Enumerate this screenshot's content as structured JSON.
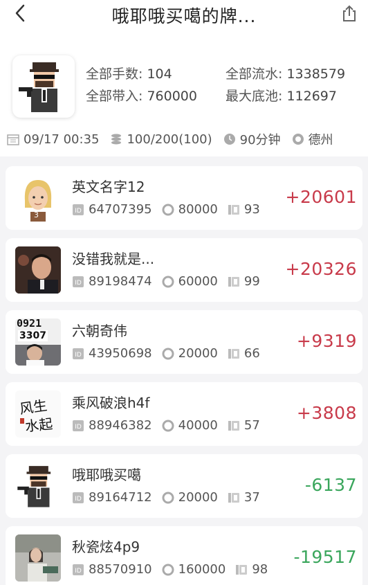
{
  "header": {
    "title": "哦耶哦买噶的牌...",
    "back_icon": "chevron-left-icon",
    "share_icon": "share-icon"
  },
  "summary": {
    "total_hands_label": "全部手数:",
    "total_hands": "104",
    "total_flow_label": "全部流水:",
    "total_flow": "1338579",
    "total_buyin_label": "全部带入:",
    "total_buyin": "760000",
    "max_pot_label": "最大底池:",
    "max_pot": "112697"
  },
  "meta": {
    "datetime": "09/17 00:35",
    "blinds": "100/200(100)",
    "duration": "90分钟",
    "game_type": "德州"
  },
  "players": [
    {
      "name": "英文名字12",
      "id": "64707395",
      "buyin": "80000",
      "hands": "93",
      "score": "+20601",
      "badge": "3",
      "avatar": "blonde-woman-avatar"
    },
    {
      "name": "没错我就是...",
      "id": "89198474",
      "buyin": "60000",
      "hands": "99",
      "score": "+20326",
      "avatar": "photo-man-avatar"
    },
    {
      "name": "六朝奇伟",
      "id": "43950698",
      "buyin": "20000",
      "hands": "66",
      "score": "+9319",
      "avatar_text1": "0921",
      "avatar_text2": "3307",
      "avatar": "photo-plate-avatar"
    },
    {
      "name": "乘风破浪h4f",
      "id": "88946382",
      "buyin": "40000",
      "hands": "57",
      "score": "+3808",
      "avatar_text1": "风生",
      "avatar_text2": "水起",
      "avatar": "calligraphy-avatar"
    },
    {
      "name": "哦耶哦买噶",
      "id": "89164712",
      "buyin": "20000",
      "hands": "37",
      "score": "-6137",
      "avatar": "gangster-avatar"
    },
    {
      "name": "秋瓷炫4p9",
      "id": "88570910",
      "buyin": "160000",
      "hands": "98",
      "score": "-19517",
      "avatar": "photo-woman-avatar"
    }
  ],
  "colors": {
    "positive": "#c83a4a",
    "negative": "#3aa65c",
    "list_bg": "#f4f4f6"
  }
}
